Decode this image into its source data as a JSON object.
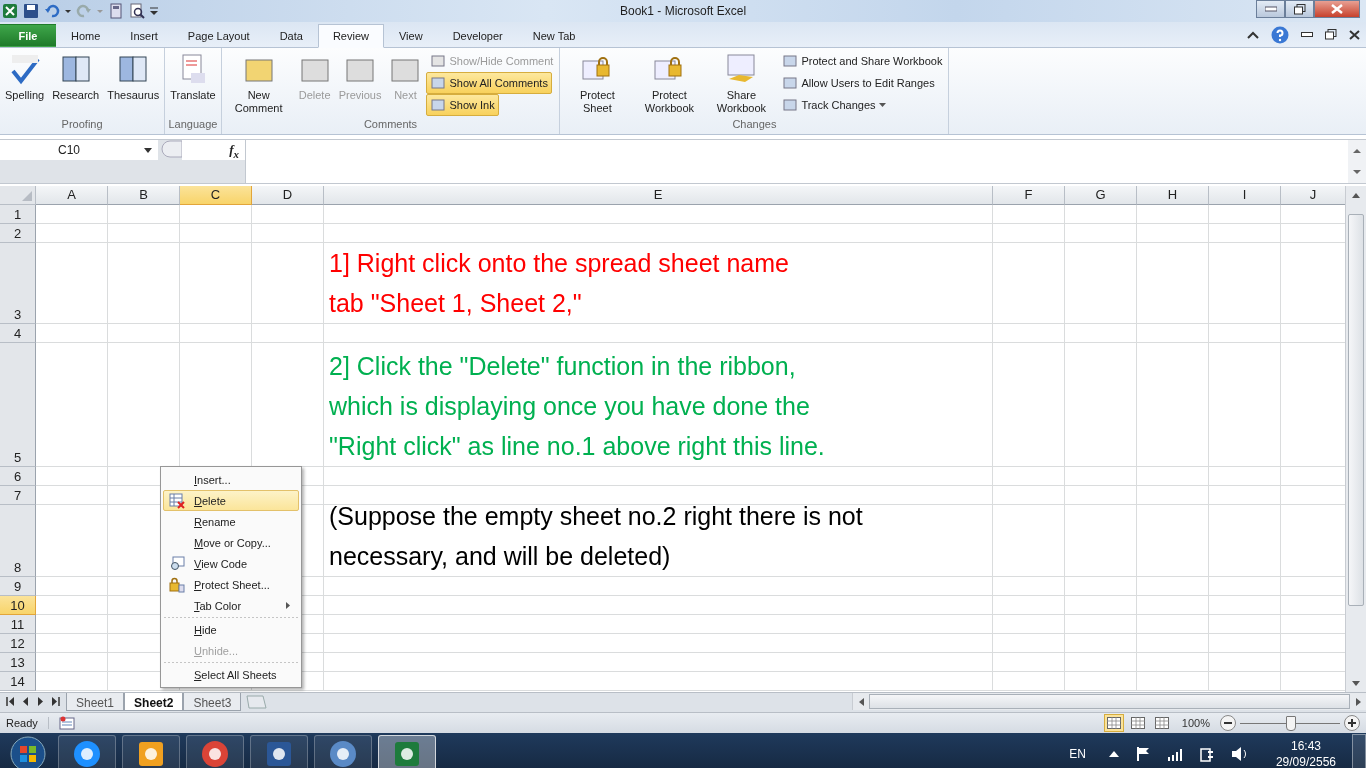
{
  "window": {
    "title": "Book1 - Microsoft Excel"
  },
  "tabs": [
    {
      "label": "File",
      "kind": "file",
      "selected": false
    },
    {
      "label": "Home",
      "kind": "tab",
      "selected": false
    },
    {
      "label": "Insert",
      "kind": "tab",
      "selected": false
    },
    {
      "label": "Page Layout",
      "kind": "tab",
      "selected": false
    },
    {
      "label": "Data",
      "kind": "tab",
      "selected": false
    },
    {
      "label": "Review",
      "kind": "tab",
      "selected": true
    },
    {
      "label": "View",
      "kind": "tab",
      "selected": false
    },
    {
      "label": "Developer",
      "kind": "tab",
      "selected": false
    },
    {
      "label": "New Tab",
      "kind": "tab",
      "selected": false
    }
  ],
  "ribbon": {
    "groups": [
      {
        "label": "Proofing",
        "buttons": [
          {
            "label": "Spelling",
            "kind": "large",
            "disabled": false,
            "on": false
          },
          {
            "label": "Research",
            "kind": "large",
            "disabled": false,
            "on": false
          },
          {
            "label": "Thesaurus",
            "kind": "large",
            "disabled": false,
            "on": false
          }
        ]
      },
      {
        "label": "Language",
        "buttons": [
          {
            "label": "Translate",
            "kind": "large",
            "disabled": false,
            "on": false
          }
        ]
      },
      {
        "label": "Comments",
        "buttons": [
          {
            "label": "New Comment",
            "kind": "large",
            "disabled": false,
            "on": false
          },
          {
            "label": "Delete",
            "kind": "large",
            "disabled": true,
            "on": false
          },
          {
            "label": "Previous",
            "kind": "large",
            "disabled": true,
            "on": false
          },
          {
            "label": "Next",
            "kind": "large",
            "disabled": true,
            "on": false
          },
          {
            "label": "Show/Hide Comment",
            "kind": "small",
            "disabled": true,
            "on": false
          },
          {
            "label": "Show All Comments",
            "kind": "small",
            "disabled": false,
            "on": true
          },
          {
            "label": "Show Ink",
            "kind": "small",
            "disabled": false,
            "on": true
          }
        ]
      },
      {
        "label": "Changes",
        "buttons": [
          {
            "label": "Protect Sheet",
            "kind": "large",
            "disabled": false,
            "on": false
          },
          {
            "label": "Protect Workbook",
            "kind": "large",
            "disabled": false,
            "on": false
          },
          {
            "label": "Share Workbook",
            "kind": "large",
            "disabled": false,
            "on": false
          },
          {
            "label": "Protect and Share Workbook",
            "kind": "small",
            "disabled": false,
            "on": false
          },
          {
            "label": "Allow Users to Edit Ranges",
            "kind": "small",
            "disabled": false,
            "on": false
          },
          {
            "label": "Track Changes",
            "kind": "dropdown",
            "disabled": false,
            "on": false
          }
        ]
      }
    ]
  },
  "formula_bar": {
    "name_box": "C10",
    "function_button": "f$_{x}$"
  },
  "grid": {
    "columns": [
      {
        "label": "A",
        "selected": false
      },
      {
        "label": "B",
        "selected": false
      },
      {
        "label": "C",
        "selected": true
      },
      {
        "label": "D",
        "selected": false
      },
      {
        "label": "E",
        "selected": false
      },
      {
        "label": "F",
        "selected": false
      },
      {
        "label": "G",
        "selected": false
      },
      {
        "label": "H",
        "selected": false
      },
      {
        "label": "I",
        "selected": false
      },
      {
        "label": "J",
        "selected": false
      }
    ],
    "rows": [
      {
        "label": "1",
        "selected": false
      },
      {
        "label": "2",
        "selected": false
      },
      {
        "label": "3",
        "selected": false,
        "text": "1] Right click onto the spread sheet name\ntab \"Sheet 1, Sheet 2,\"",
        "color": "#ff0000"
      },
      {
        "label": "4",
        "selected": false
      },
      {
        "label": "5",
        "selected": false,
        "text": "2] Click the \"Delete\" function in the ribbon,\nwhich is displaying once you have done the\n\"Right click\" as line no.1 above right this line.",
        "color": "#00b050"
      },
      {
        "label": "6",
        "selected": false
      },
      {
        "label": "7",
        "selected": false
      },
      {
        "label": "8",
        "selected": false,
        "text": "(Suppose the empty sheet no.2 right there is not\nnecessary, and will be deleted)",
        "color": "#000000"
      },
      {
        "label": "9",
        "selected": false
      },
      {
        "label": "10",
        "selected": true
      },
      {
        "label": "11",
        "selected": false
      },
      {
        "label": "12",
        "selected": false
      },
      {
        "label": "13",
        "selected": false
      },
      {
        "label": "14",
        "selected": false
      }
    ]
  },
  "sheet_tabs": [
    {
      "label": "Sheet1",
      "selected": false
    },
    {
      "label": "Sheet2",
      "selected": true
    },
    {
      "label": "Sheet3",
      "selected": false
    }
  ],
  "context_menu": [
    {
      "label": "Insert...",
      "disabled": false,
      "selected": false,
      "submenu": false,
      "separator_after": false
    },
    {
      "label": "Delete",
      "disabled": false,
      "selected": true,
      "submenu": false,
      "separator_after": false
    },
    {
      "label": "Rename",
      "disabled": false,
      "selected": false,
      "submenu": false,
      "separator_after": false
    },
    {
      "label": "Move or Copy...",
      "disabled": false,
      "selected": false,
      "submenu": false,
      "separator_after": false
    },
    {
      "label": "View Code",
      "disabled": false,
      "selected": false,
      "submenu": false,
      "separator_after": false
    },
    {
      "label": "Protect Sheet...",
      "disabled": false,
      "selected": false,
      "submenu": false,
      "separator_after": false
    },
    {
      "label": "Tab Color",
      "disabled": false,
      "selected": false,
      "submenu": true,
      "separator_after": true
    },
    {
      "label": "Hide",
      "disabled": false,
      "selected": false,
      "submenu": false,
      "separator_after": false
    },
    {
      "label": "Unhide...",
      "disabled": true,
      "selected": false,
      "submenu": false,
      "separator_after": true
    },
    {
      "label": "Select All Sheets",
      "disabled": false,
      "selected": false,
      "submenu": false,
      "separator_after": false
    }
  ],
  "status_bar": {
    "status": "Ready",
    "views": [
      {
        "selected": true
      },
      {
        "selected": false
      },
      {
        "selected": false
      }
    ],
    "zoom": "100%",
    "zoom_slider": {
      "level": 0.5
    }
  },
  "taskbar": {
    "apps": [
      {
        "selected": false
      },
      {
        "selected": false
      },
      {
        "selected": false
      },
      {
        "selected": false
      },
      {
        "selected": false
      },
      {
        "selected": true
      }
    ],
    "language": "EN",
    "time": "16:43",
    "date": "29/09/2556"
  }
}
